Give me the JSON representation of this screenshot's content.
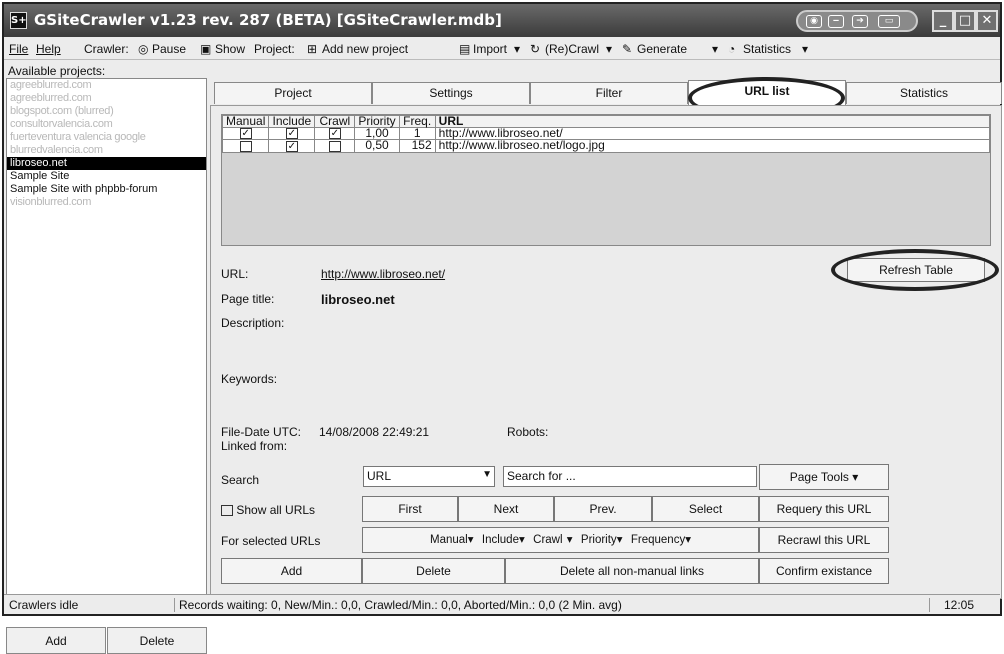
{
  "window": {
    "title": "GSiteCrawler v1.23 rev. 287 (BETA) [GSiteCrawler.mdb]",
    "icon": "S+"
  },
  "menu": {
    "file": "File",
    "help": "Help",
    "crawler": "Crawler:",
    "pause": "Pause",
    "show": "Show",
    "project": "Project:",
    "add_new": "Add new project",
    "import": "Import",
    "recrawl": "(Re)Crawl",
    "generate": "Generate",
    "statistics": "Statistics"
  },
  "sidebar": {
    "header": "Available projects:",
    "projects": [
      "agreeblurred.com",
      "agreeblurred.com",
      "blogspot.com (blurred)",
      "consultorvalencia.com",
      "fuerteventura valencia google",
      "blurredvalencia.com",
      "libroseo.net",
      "Sample Site",
      "Sample Site with phpbb-forum",
      "visionblurred.com"
    ],
    "add": "Add",
    "delete": "Delete"
  },
  "tabs": [
    "Project",
    "Settings",
    "Filter",
    "URL list",
    "Statistics"
  ],
  "grid": {
    "columns": [
      "Manual",
      "Include",
      "Crawl",
      "Priority",
      "Freq.",
      "URL"
    ],
    "rows": [
      {
        "manual": true,
        "include": true,
        "crawl": true,
        "priority": "1,00",
        "freq": "1",
        "url": "http://www.libroseo.net/"
      },
      {
        "manual": false,
        "include": true,
        "crawl": false,
        "priority": "0,50",
        "freq": "152",
        "url": "http://www.libroseo.net/logo.jpg"
      }
    ]
  },
  "detail": {
    "url_label": "URL:",
    "url_value": "http://www.libroseo.net/",
    "title_label": "Page title:",
    "title_value": "libroseo.net",
    "desc_label": "Description:",
    "keywords_label": "Keywords:",
    "filedate_label": "File-Date UTC:",
    "filedate_value": "14/08/2008 22:49:21",
    "robots_label": "Robots:",
    "linked_label": "Linked from:"
  },
  "controls": {
    "refresh": "Refresh Table",
    "search_label": "Search",
    "search_field": "URL",
    "search_placeholder": "Search for ...",
    "page_tools": "Page Tools",
    "show_all": "Show all URLs",
    "first": "First",
    "next": "Next",
    "prev": "Prev.",
    "select": "Select",
    "requery": "Requery this URL",
    "for_selected": "For selected URLs",
    "manual_dd": "Manual",
    "include_dd": "Include",
    "crawl_dd": "Crawl",
    "priority_dd": "Priority",
    "frequency_dd": "Frequency",
    "recrawl": "Recrawl this URL",
    "add": "Add",
    "delete": "Delete",
    "delete_nonmanual": "Delete all non-manual links",
    "confirm": "Confirm existance"
  },
  "status": {
    "left": "Crawlers idle",
    "center": "Records waiting: 0, New/Min.: 0,0, Crawled/Min.: 0,0, Aborted/Min.: 0,0 (2 Min. avg)",
    "time": "12:05"
  }
}
